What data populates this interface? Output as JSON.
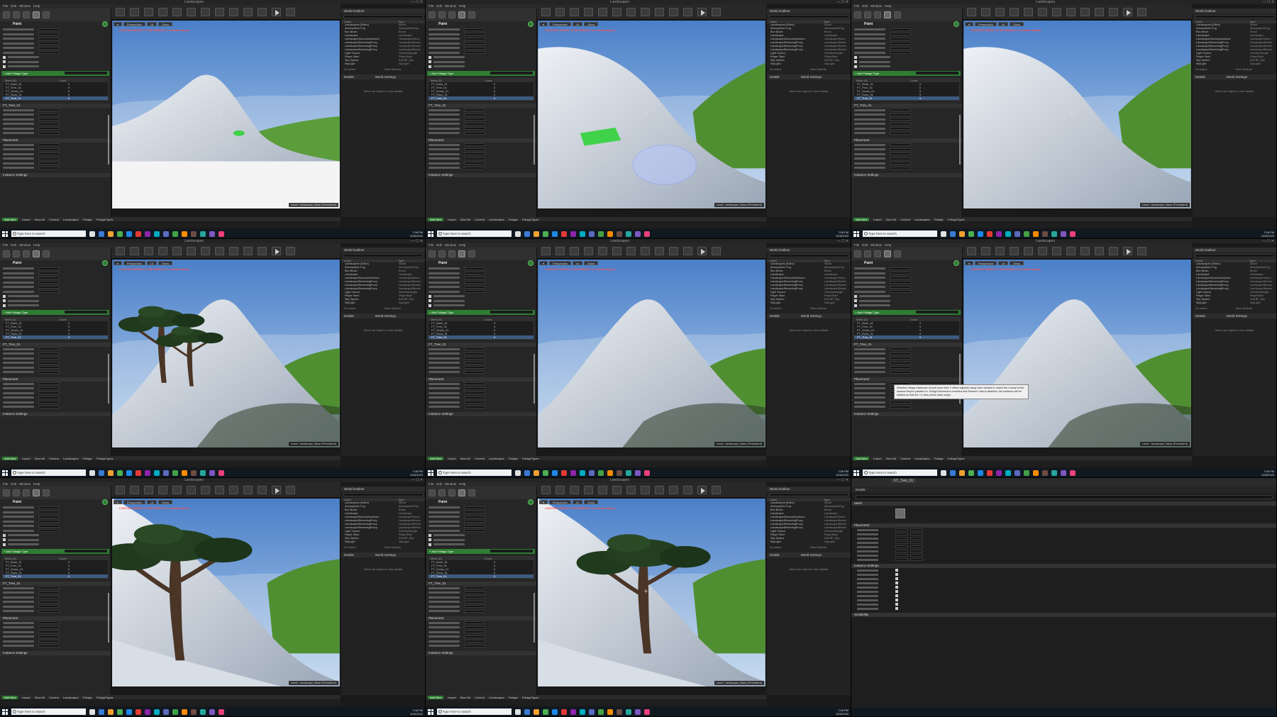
{
  "app": {
    "window_title": "Landscapes",
    "menu": [
      "File",
      "Edit",
      "Window",
      "Help"
    ],
    "window_controls": "—  ☐  ✕"
  },
  "mode_panel": {
    "title": "Paint",
    "add_new_label": "+ Add Foliage Type",
    "mesh_columns": [
      "Mesh (5)",
      "Count"
    ],
    "mesh_rows": [
      {
        "name": "FT_Bush_01",
        "count": "0"
      },
      {
        "name": "FT_Fern_01",
        "count": "0"
      },
      {
        "name": "FT_Grass_01",
        "count": "0"
      },
      {
        "name": "FT_Rock_01",
        "count": "0"
      },
      {
        "name": "FT_Tree_01",
        "count": "0"
      }
    ],
    "sections": [
      "FT_Tree_01",
      "Painting",
      "Placement",
      "Instance Settings"
    ]
  },
  "viewport": {
    "buttons": [
      "Perspective",
      "Lit",
      "Show"
    ],
    "warning": "LIGHTING NEEDS TO BE REBUILT (1 unbuilt object)",
    "level_label": "Level: Landscape_Base (Persistent)"
  },
  "outliner": {
    "tab": "World Outliner",
    "columns": [
      "Label",
      "Type"
    ],
    "rows": [
      {
        "label": "Landscapes (Editor)",
        "type": "World"
      },
      {
        "label": "Atmospheric Fog",
        "type": "AtmosphericFog"
      },
      {
        "label": "Box Brush",
        "type": "Brush"
      },
      {
        "label": "Landscape",
        "type": "Landscape"
      },
      {
        "label": "LandscapeGizmoActiveActor",
        "type": "LandscapeGizmo"
      },
      {
        "label": "LandscapeStreamingProxy",
        "type": "LandscapeStream"
      },
      {
        "label": "LandscapeStreamingProxy",
        "type": "LandscapeStream"
      },
      {
        "label": "LandscapeStreamingProxy",
        "type": "LandscapeStream"
      },
      {
        "label": "Light Source",
        "type": "DirectionalLight"
      },
      {
        "label": "Player Start",
        "type": "PlayerStart"
      },
      {
        "label": "Sky Sphere",
        "type": "Edit BP_Sky"
      },
      {
        "label": "SkyLight",
        "type": "SkyLight"
      }
    ],
    "count": "24 actors",
    "view_options": "View Options"
  },
  "details": {
    "tab": "Details",
    "world_settings": "World Settings",
    "empty": "Select an object to view details."
  },
  "content_browser": {
    "add_new": "Add New",
    "import": "Import",
    "save_all": "Save All",
    "crumbs": [
      "Content",
      "Landscapes",
      "Foliage",
      "FoliageTypes"
    ]
  },
  "taskbar": {
    "search_placeholder": "Type here to search",
    "time": "7:08 PM",
    "date": "3/26/2020"
  },
  "tooltip": {
    "text": "Whether foliage instances should have their Z offset adjusted away from vertical to match the normal of the surface they're painted on. If AlignToNormal is enabled and Random Yaw is disabled, the instance will be rotated so that the +X axis points down-slope."
  },
  "foliage_editor": {
    "tab_title": "FT_Tree_01",
    "tabs": [
      "Details"
    ],
    "sections": [
      "Mesh",
      "Placement",
      "Instance Settings",
      "Scalability"
    ]
  },
  "colors": {
    "brand_green": "#2e7d32",
    "selection_blue": "#3d5a80",
    "warning_red": "#ff5252",
    "taskbar": "#101820"
  }
}
